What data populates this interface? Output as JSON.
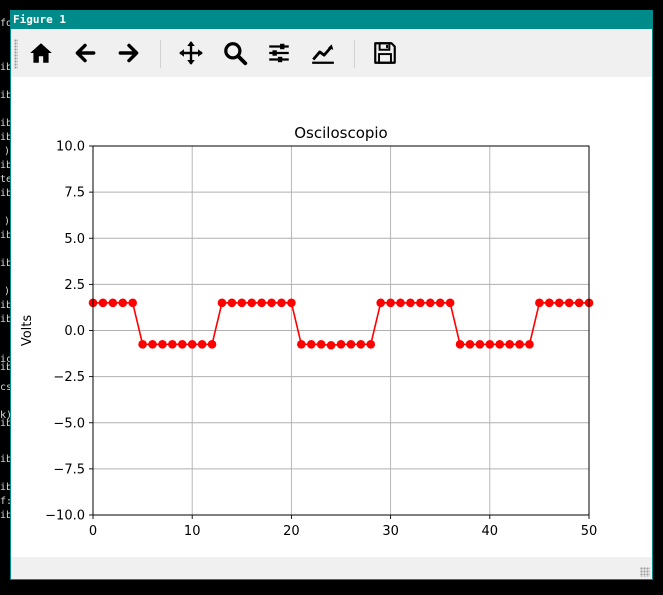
{
  "terminal": {
    "fragments": [
      "fo",
      "ib",
      "ib",
      "ib",
      "ib",
      ")",
      "ib",
      "te",
      "ib",
      ")",
      "ib",
      "ib",
      ")",
      "ib",
      "ib",
      "ic",
      "ib",
      "cs",
      "k)",
      "ib",
      "ib",
      "ib",
      "f:",
      "ib"
    ]
  },
  "window": {
    "title": "Figure 1"
  },
  "toolbar": {
    "icons": [
      "home-icon",
      "back-arrow-icon",
      "forward-arrow-icon",
      "pan-icon",
      "zoom-icon",
      "subplots-icon",
      "axes-line-icon",
      "save-icon"
    ]
  },
  "colors": {
    "accent": "#008b8b",
    "series": "#ff0000",
    "grid": "#b0b0b0",
    "toolbar_bg": "#f0f0f0"
  },
  "chart_data": {
    "type": "line",
    "title": "Osciloscopio",
    "xlabel": "",
    "ylabel": "Volts",
    "xlim": [
      0,
      50
    ],
    "ylim": [
      -10,
      10
    ],
    "xticks": [
      0,
      10,
      20,
      30,
      40,
      50
    ],
    "yticks": [
      -10.0,
      -7.5,
      -5.0,
      -2.5,
      0.0,
      2.5,
      5.0,
      7.5,
      10.0
    ],
    "xtick_labels": [
      "0",
      "10",
      "20",
      "30",
      "40",
      "50"
    ],
    "ytick_labels": [
      "−10.0",
      "−7.5",
      "−5.0",
      "−2.5",
      "0.0",
      "2.5",
      "5.0",
      "7.5",
      "10.0"
    ],
    "grid": true,
    "series": [
      {
        "color": "#ff0000",
        "marker": "circle",
        "x": [
          0,
          1,
          2,
          3,
          4,
          5,
          6,
          7,
          8,
          9,
          10,
          11,
          12,
          13,
          14,
          15,
          16,
          17,
          18,
          19,
          20,
          21,
          22,
          23,
          24,
          25,
          26,
          27,
          28,
          29,
          30,
          31,
          32,
          33,
          34,
          35,
          36,
          37,
          38,
          39,
          40,
          41,
          42,
          43,
          44,
          45,
          46,
          47,
          48,
          49,
          50
        ],
        "y": [
          1.5,
          1.5,
          1.5,
          1.5,
          1.5,
          -0.75,
          -0.75,
          -0.75,
          -0.75,
          -0.75,
          -0.75,
          -0.75,
          -0.75,
          1.5,
          1.5,
          1.5,
          1.5,
          1.5,
          1.5,
          1.5,
          1.5,
          -0.75,
          -0.75,
          -0.75,
          -0.8,
          -0.75,
          -0.75,
          -0.75,
          -0.75,
          1.5,
          1.5,
          1.5,
          1.5,
          1.5,
          1.5,
          1.5,
          1.5,
          -0.75,
          -0.75,
          -0.75,
          -0.75,
          -0.75,
          -0.75,
          -0.75,
          -0.75,
          1.5,
          1.5,
          1.5,
          1.5,
          1.5,
          1.5
        ]
      }
    ]
  }
}
